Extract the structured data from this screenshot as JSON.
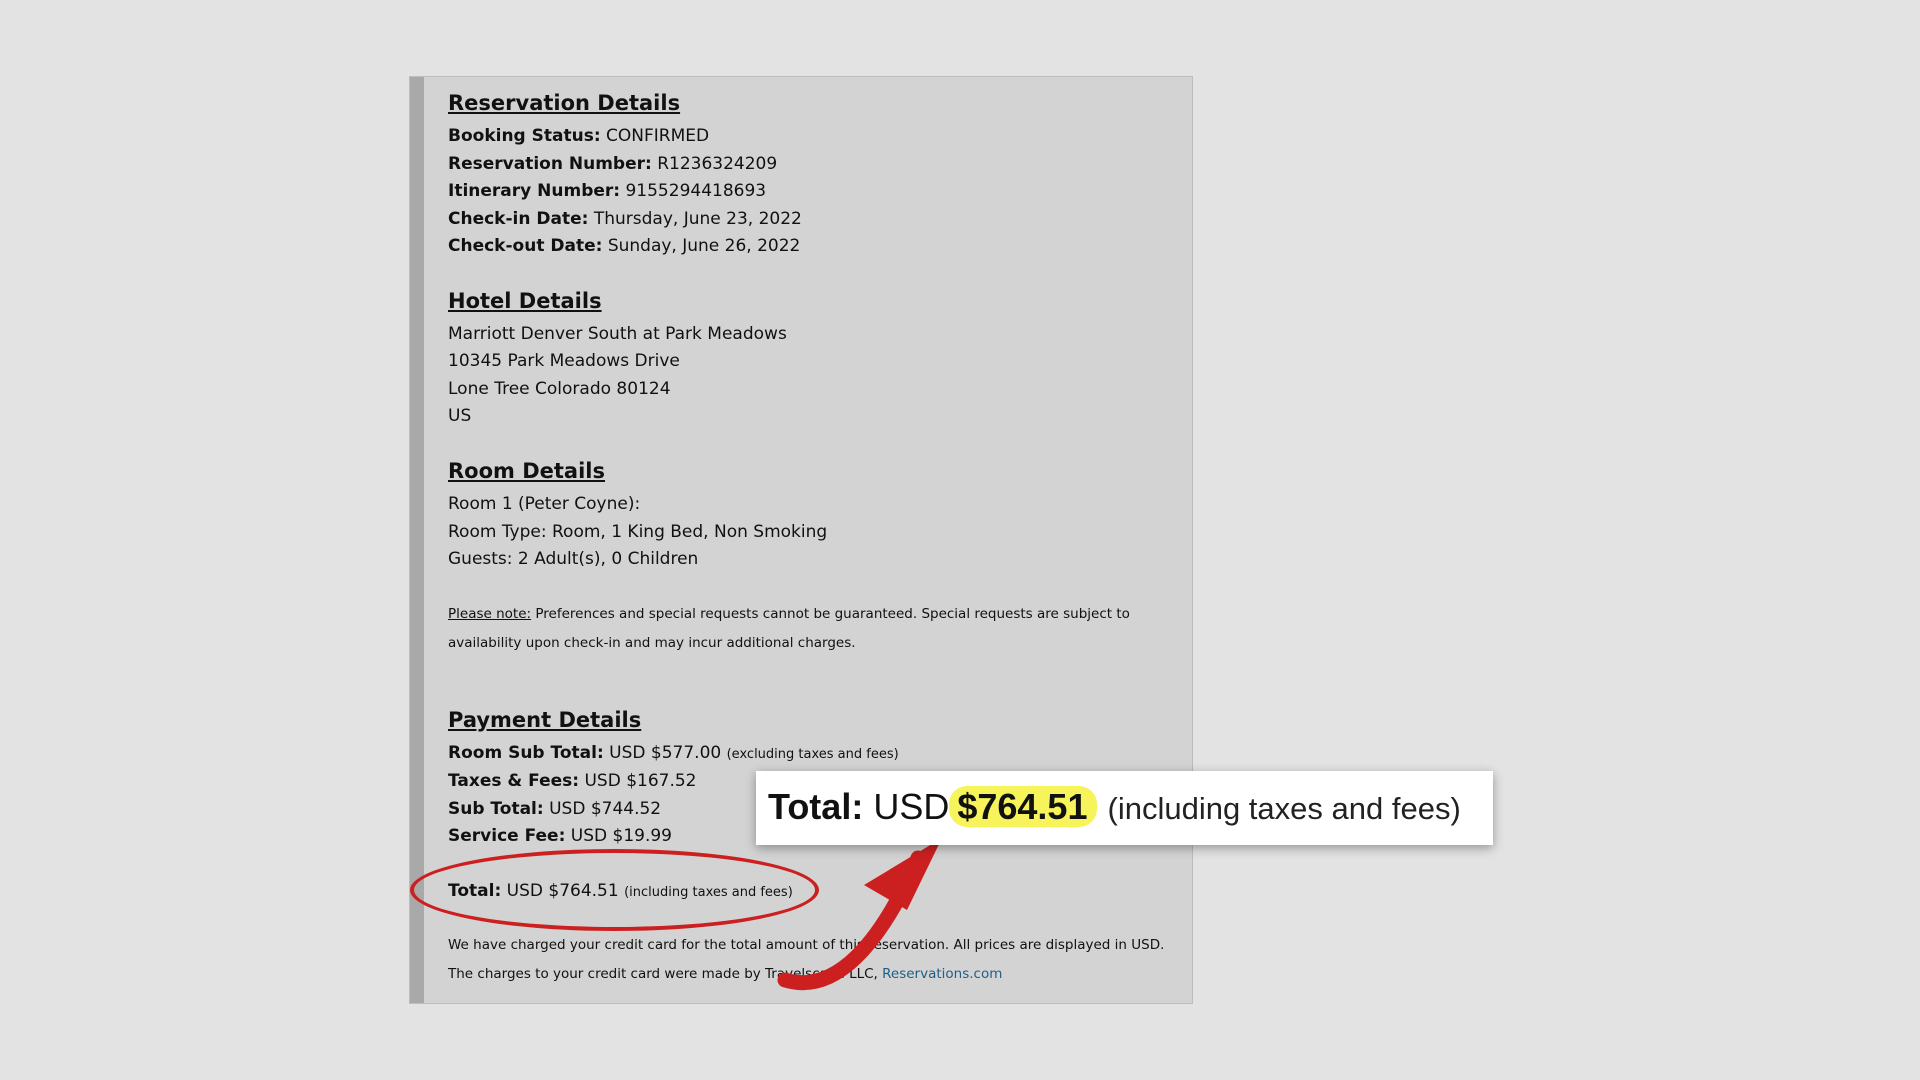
{
  "reservation": {
    "title": "Reservation Details",
    "booking_status_label": "Booking Status:",
    "booking_status": "CONFIRMED",
    "reservation_number_label": "Reservation Number:",
    "reservation_number": "R1236324209",
    "itinerary_number_label": "Itinerary Number:",
    "itinerary_number": "9155294418693",
    "checkin_label": "Check-in Date:",
    "checkin": "Thursday, June 23, 2022",
    "checkout_label": "Check-out Date:",
    "checkout": "Sunday, June 26, 2022"
  },
  "hotel": {
    "title": "Hotel Details",
    "name": "Marriott Denver South at Park Meadows",
    "street": "10345 Park Meadows Drive",
    "city": "Lone Tree Colorado 80124",
    "country": "US"
  },
  "room": {
    "title": "Room Details",
    "room_line": "Room 1 (Peter Coyne):",
    "room_type": "Room Type: Room, 1 King Bed, Non Smoking",
    "guests": "Guests: 2 Adult(s), 0 Children"
  },
  "note": {
    "label": "Please note:",
    "text": " Preferences and special requests cannot be guaranteed. Special requests are subject to availability upon check-in and may incur additional charges."
  },
  "payment": {
    "title": "Payment Details",
    "room_subtotal_label": "Room Sub Total:",
    "room_subtotal": "USD $577.00",
    "room_subtotal_note": "(excluding taxes and fees)",
    "taxes_label": "Taxes & Fees:",
    "taxes": "USD $167.52",
    "subtotal_label": "Sub Total:",
    "subtotal": "USD $744.52",
    "service_fee_label": "Service Fee:",
    "service_fee": "USD $19.99",
    "total_label": "Total:",
    "total": "USD $764.51",
    "total_note": "(including taxes and fees)",
    "charge_text": "We have charged your credit card for the total amount of this reservation. All prices are displayed in USD. The charges to your credit card were made by Travelscape LLC, ",
    "charge_link": "Reservations.com"
  },
  "callout": {
    "total_label": "Total:",
    "currency": "USD",
    "amount": "$764.51",
    "note": "(including taxes and fees)"
  },
  "colors": {
    "annotation_red": "#cc2020",
    "highlight_yellow": "#f7f35a",
    "link_blue": "#1f5f87"
  }
}
